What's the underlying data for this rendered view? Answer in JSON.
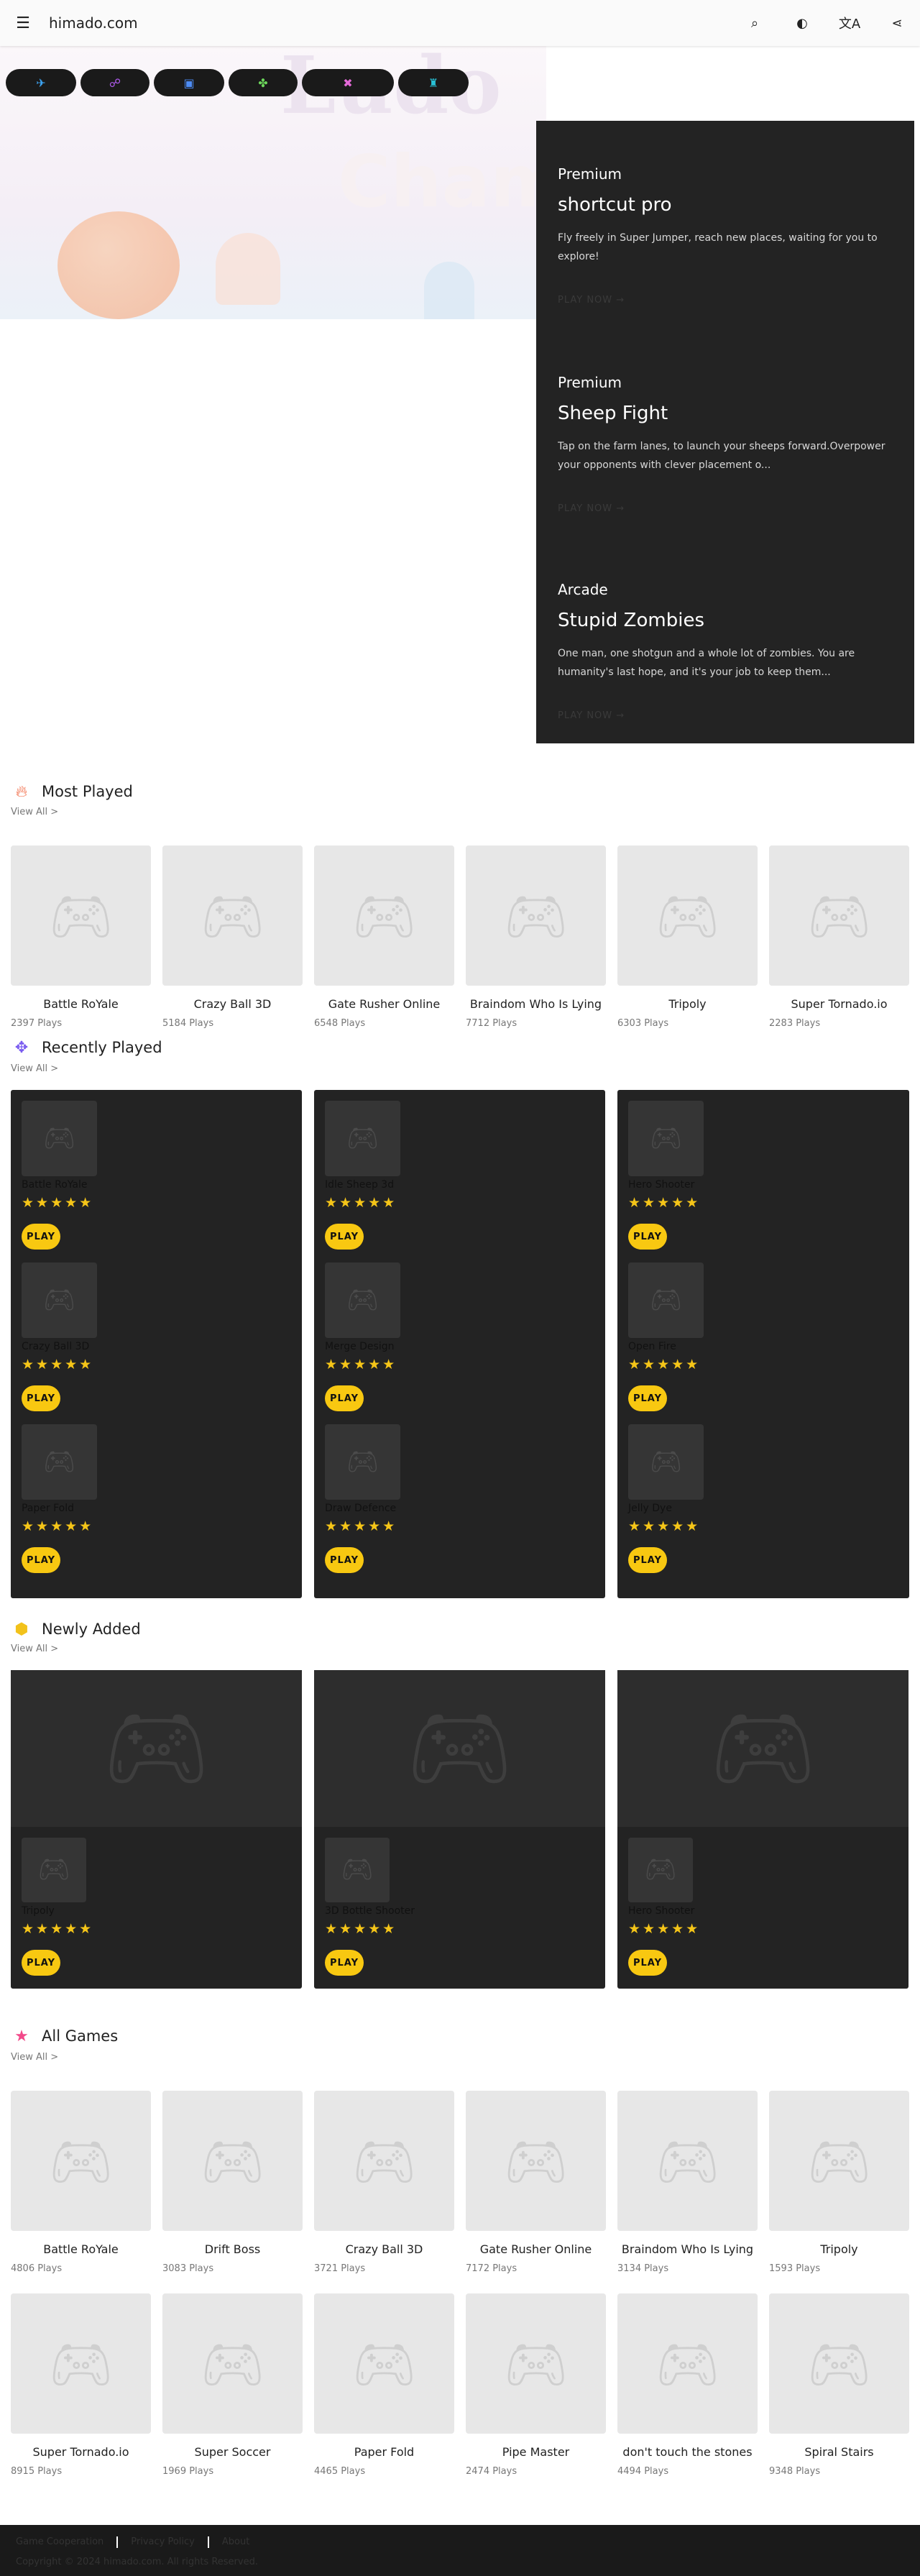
{
  "header": {
    "menu_icon": "menu-icon",
    "title": "himado.com",
    "actions": [
      {
        "name": "search-icon",
        "glyph": "⌕"
      },
      {
        "name": "theme-toggle-icon",
        "glyph": "◐"
      },
      {
        "name": "translate-icon",
        "glyph": "文A"
      },
      {
        "name": "share-icon",
        "glyph": "⋖"
      }
    ]
  },
  "hero": {
    "categories": [
      {
        "name": "category-action-icon",
        "glyph": "✈",
        "color": "#3da5f4"
      },
      {
        "name": "category-casual-icon",
        "glyph": "☍",
        "color": "#b15cf0"
      },
      {
        "name": "category-board-icon",
        "glyph": "▣",
        "color": "#4d8cf5"
      },
      {
        "name": "category-puzzle-icon",
        "glyph": "✤",
        "color": "#6cd65b"
      },
      {
        "name": "category-strategy-icon",
        "glyph": "✖",
        "color": "#e46ad9"
      },
      {
        "name": "category-sports-icon",
        "glyph": "♜",
        "color": "#29c1d6"
      }
    ]
  },
  "featured": [
    {
      "category": "Premium",
      "title": "shortcut pro",
      "description": "Fly freely in Super Jumper, reach new places, waiting for you to explore!",
      "cta": "PLAY NOW  →"
    },
    {
      "category": "Premium",
      "title": "Sheep Fight",
      "description": "Tap on the farm lanes, to launch your sheeps forward.Overpower your opponents with clever placement o...",
      "cta": "PLAY NOW  →"
    },
    {
      "category": "Arcade",
      "title": "Stupid Zombies",
      "description": "One man, one shotgun and a whole lot of zombies. You are humanity's last hope, and it's your job to keep them...",
      "cta": "PLAY NOW  →"
    }
  ],
  "most_played": {
    "title": "Most Played",
    "view_all": "View All >",
    "games": [
      {
        "name": "Battle RoYale",
        "plays": "2397 Plays"
      },
      {
        "name": "Crazy Ball 3D",
        "plays": "5184 Plays"
      },
      {
        "name": "Gate Rusher Online",
        "plays": "6548 Plays"
      },
      {
        "name": "Braindom Who Is Lying",
        "plays": "7712 Plays"
      },
      {
        "name": "Tripoly",
        "plays": "6303 Plays"
      },
      {
        "name": "Super Tornado.io",
        "plays": "2283 Plays"
      }
    ]
  },
  "recently_played": {
    "title": "Recently Played",
    "view_all": "View All >",
    "columns": [
      [
        {
          "name": "Battle RoYale",
          "rating": 5,
          "stars": "★★★★★",
          "play": "PLAY"
        },
        {
          "name": "Crazy Ball 3D",
          "rating": 5,
          "stars": "★★★★★",
          "play": "PLAY"
        },
        {
          "name": "Paper Fold",
          "rating": 5,
          "stars": "★★★★★",
          "play": "PLAY"
        }
      ],
      [
        {
          "name": "Idle Sheep 3d",
          "rating": 5,
          "stars": "★★★★★",
          "play": "PLAY"
        },
        {
          "name": "Merge Design",
          "rating": 5,
          "stars": "★★★★★",
          "play": "PLAY"
        },
        {
          "name": "Draw Defence",
          "rating": 5,
          "stars": "★★★★★",
          "play": "PLAY"
        }
      ],
      [
        {
          "name": "Hero Shooter",
          "rating": 5,
          "stars": "★★★★★",
          "play": "PLAY"
        },
        {
          "name": "Open Fire",
          "rating": 5,
          "stars": "★★★★★",
          "play": "PLAY"
        },
        {
          "name": "Jelly Dye",
          "rating": 5,
          "stars": "★★★★★",
          "play": "PLAY"
        }
      ]
    ]
  },
  "newly_added": {
    "title": "Newly Added",
    "view_all": "View All >",
    "cards": [
      {
        "name": "Tripoly",
        "rating": 5,
        "stars": "★★★★★",
        "play": "PLAY"
      },
      {
        "name": "3D Bottle Shooter",
        "rating": 5,
        "stars": "★★★★★",
        "play": "PLAY"
      },
      {
        "name": "Hero Shooter",
        "rating": 5,
        "stars": "★★★★★",
        "play": "PLAY"
      }
    ]
  },
  "all_games": {
    "title": "All Games",
    "view_all": "View All >",
    "rows": [
      [
        {
          "name": "Battle RoYale",
          "plays": "4806 Plays"
        },
        {
          "name": "Drift Boss",
          "plays": "3083 Plays"
        },
        {
          "name": "Crazy Ball 3D",
          "plays": "3721 Plays"
        },
        {
          "name": "Gate Rusher Online",
          "plays": "7172 Plays"
        },
        {
          "name": "Braindom Who Is Lying",
          "plays": "3134 Plays"
        },
        {
          "name": "Tripoly",
          "plays": "1593 Plays"
        }
      ],
      [
        {
          "name": "Super Tornado.io",
          "plays": "8915 Plays"
        },
        {
          "name": "Super Soccer",
          "plays": "1969 Plays"
        },
        {
          "name": "Paper Fold",
          "plays": "4465 Plays"
        },
        {
          "name": "Pipe Master",
          "plays": "2474 Plays"
        },
        {
          "name": "don't touch the stones",
          "plays": "4494 Plays"
        },
        {
          "name": "Spiral Stairs",
          "plays": "9348 Plays"
        }
      ]
    ]
  },
  "footer": {
    "links": [
      "Game Cooperation",
      "Privacy Policy",
      "About"
    ],
    "copyright": "Copyright © 2024 himado.com. All rights Reserved."
  },
  "colors": {
    "accent_yellow": "#f8c811",
    "dark_panel": "#232323",
    "placeholder": "#e7e7e7"
  }
}
